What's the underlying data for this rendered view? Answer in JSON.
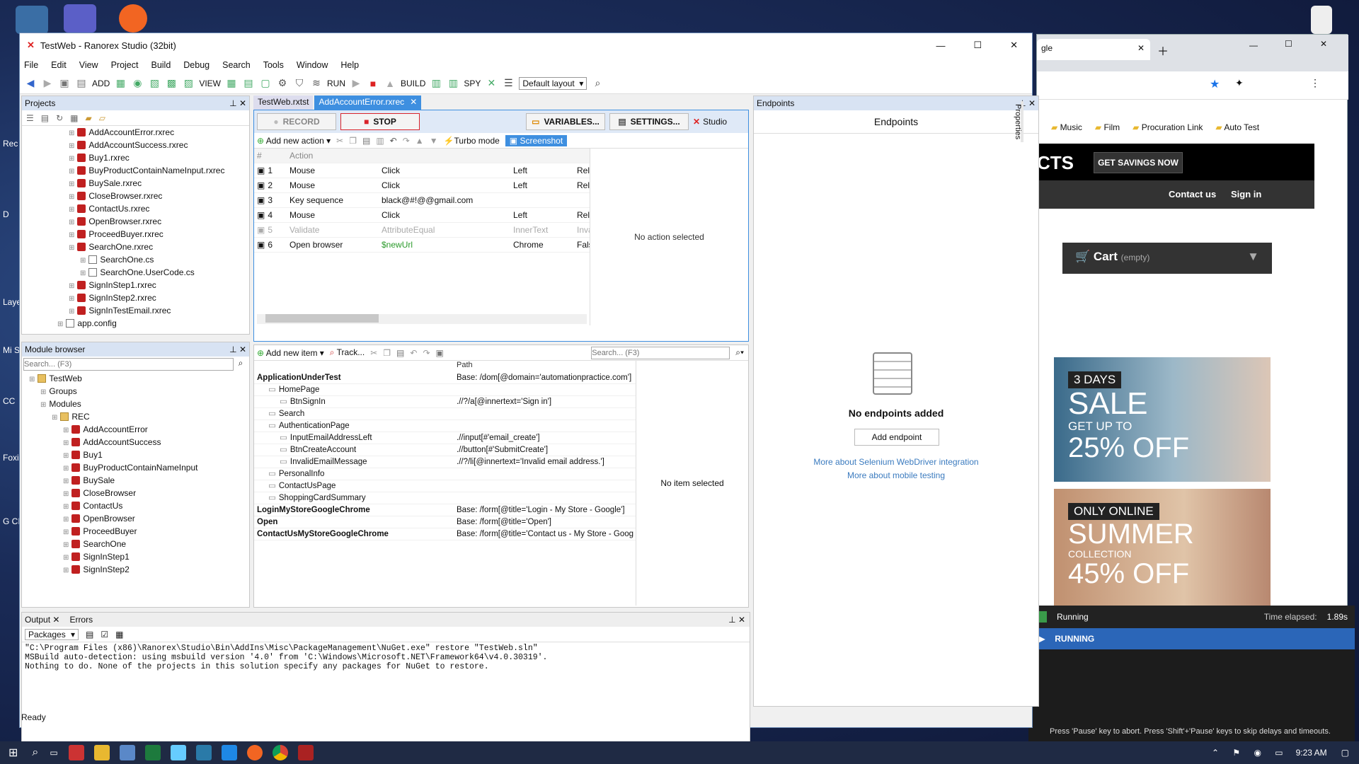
{
  "desktop": {
    "labels": [
      "Rec",
      "D",
      "Laye",
      "Mi SQL",
      "CC",
      "Foxi",
      "G CI"
    ]
  },
  "window": {
    "title": "TestWeb - Ranorex Studio (32bit)"
  },
  "menu": [
    "File",
    "Edit",
    "View",
    "Project",
    "Build",
    "Debug",
    "Search",
    "Tools",
    "Window",
    "Help"
  ],
  "toolbar": {
    "add": "ADD",
    "view": "VIEW",
    "run": "RUN",
    "build": "BUILD",
    "spy": "SPY",
    "layout": "Default layout"
  },
  "projects": {
    "title": "Projects",
    "items": [
      {
        "label": "AddAccountError.rxrec",
        "indent": 1,
        "type": "rx"
      },
      {
        "label": "AddAccountSuccess.rxrec",
        "indent": 1,
        "type": "rx"
      },
      {
        "label": "Buy1.rxrec",
        "indent": 1,
        "type": "rx"
      },
      {
        "label": "BuyProductContainNameInput.rxrec",
        "indent": 1,
        "type": "rx"
      },
      {
        "label": "BuySale.rxrec",
        "indent": 1,
        "type": "rx"
      },
      {
        "label": "CloseBrowser.rxrec",
        "indent": 1,
        "type": "rx"
      },
      {
        "label": "ContactUs.rxrec",
        "indent": 1,
        "type": "rx"
      },
      {
        "label": "OpenBrowser.rxrec",
        "indent": 1,
        "type": "rx"
      },
      {
        "label": "ProceedBuyer.rxrec",
        "indent": 1,
        "type": "rx"
      },
      {
        "label": "SearchOne.rxrec",
        "indent": 1,
        "type": "rx"
      },
      {
        "label": "SearchOne.cs",
        "indent": 2,
        "type": "file"
      },
      {
        "label": "SearchOne.UserCode.cs",
        "indent": 2,
        "type": "file"
      },
      {
        "label": "SignInStep1.rxrec",
        "indent": 1,
        "type": "rx"
      },
      {
        "label": "SignInStep2.rxrec",
        "indent": 1,
        "type": "rx"
      },
      {
        "label": "SignInTestEmail.rxrec",
        "indent": 1,
        "type": "rx"
      },
      {
        "label": "app.config",
        "indent": 0,
        "type": "file"
      }
    ]
  },
  "module_browser": {
    "title": "Module browser",
    "search": "Search... (F3)",
    "items": [
      {
        "label": "TestWeb",
        "indent": 0,
        "type": "folder"
      },
      {
        "label": "Groups",
        "indent": 1,
        "type": "none"
      },
      {
        "label": "Modules",
        "indent": 1,
        "type": "none"
      },
      {
        "label": "REC",
        "indent": 2,
        "type": "folder"
      },
      {
        "label": "AddAccountError",
        "indent": 3,
        "type": "rx"
      },
      {
        "label": "AddAccountSuccess",
        "indent": 3,
        "type": "rx"
      },
      {
        "label": "Buy1",
        "indent": 3,
        "type": "rx"
      },
      {
        "label": "BuyProductContainNameInput",
        "indent": 3,
        "type": "rx"
      },
      {
        "label": "BuySale",
        "indent": 3,
        "type": "rx"
      },
      {
        "label": "CloseBrowser",
        "indent": 3,
        "type": "rx"
      },
      {
        "label": "ContactUs",
        "indent": 3,
        "type": "rx"
      },
      {
        "label": "OpenBrowser",
        "indent": 3,
        "type": "rx"
      },
      {
        "label": "ProceedBuyer",
        "indent": 3,
        "type": "rx"
      },
      {
        "label": "SearchOne",
        "indent": 3,
        "type": "rx"
      },
      {
        "label": "SignInStep1",
        "indent": 3,
        "type": "rx"
      },
      {
        "label": "SignInStep2",
        "indent": 3,
        "type": "rx"
      }
    ]
  },
  "tabs": [
    {
      "label": "TestWeb.rxtst",
      "active": false
    },
    {
      "label": "AddAccountError.rxrec",
      "active": true
    }
  ],
  "recorder": {
    "record": "RECORD",
    "stop": "STOP",
    "variables": "VARIABLES...",
    "settings": "SETTINGS...",
    "studio": "Studio",
    "add_action": "Add new action",
    "turbo": "Turbo mode",
    "screenshot": "Screenshot",
    "col_num": "#",
    "col_action": "Action",
    "actions": [
      {
        "n": "1",
        "type": "Mouse",
        "act": "Click",
        "p1": "Left",
        "p2": "Rela",
        "disabled": false,
        "green": false
      },
      {
        "n": "2",
        "type": "Mouse",
        "act": "Click",
        "p1": "Left",
        "p2": "Rela",
        "disabled": false,
        "green": false
      },
      {
        "n": "3",
        "type": "Key sequence",
        "act": "black@#!@@gmail.com",
        "p1": "",
        "p2": "",
        "disabled": false,
        "green": false
      },
      {
        "n": "4",
        "type": "Mouse",
        "act": "Click",
        "p1": "Left",
        "p2": "Rela",
        "disabled": false,
        "green": false
      },
      {
        "n": "5",
        "type": "Validate",
        "act": "AttributeEqual",
        "p1": "InnerText",
        "p2": "Inva",
        "disabled": true,
        "green": false
      },
      {
        "n": "6",
        "type": "Open browser",
        "act": "$newUrl",
        "p1": "Chrome",
        "p2": "False",
        "disabled": false,
        "green": true
      }
    ],
    "no_action": "No action selected"
  },
  "repository": {
    "add_item": "Add new item",
    "track": "Track...",
    "search": "Search... (F3)",
    "col_path": "Path",
    "no_item": "No item selected",
    "rows": [
      {
        "name": "ApplicationUnderTest",
        "path": "Base: /dom[@domain='automationpractice.com']",
        "indent": 0,
        "bold": true
      },
      {
        "name": "HomePage",
        "path": "",
        "indent": 1,
        "bold": false
      },
      {
        "name": "BtnSignIn",
        "path": ".//?/a[@innertext='Sign in']",
        "indent": 2,
        "bold": false
      },
      {
        "name": "Search",
        "path": "",
        "indent": 1,
        "bold": false
      },
      {
        "name": "AuthenticationPage",
        "path": "",
        "indent": 1,
        "bold": false
      },
      {
        "name": "InputEmailAddressLeft",
        "path": ".//input[#'email_create']",
        "indent": 2,
        "bold": false
      },
      {
        "name": "BtnCreateAccount",
        "path": ".//button[#'SubmitCreate']",
        "indent": 2,
        "bold": false
      },
      {
        "name": "InvalidEmailMessage",
        "path": ".//?/li[@innertext='Invalid email address.']",
        "indent": 2,
        "bold": false
      },
      {
        "name": "PersonalInfo",
        "path": "",
        "indent": 1,
        "bold": false
      },
      {
        "name": "ContactUsPage",
        "path": "",
        "indent": 1,
        "bold": false
      },
      {
        "name": "ShoppingCardSummary",
        "path": "",
        "indent": 1,
        "bold": false
      },
      {
        "name": "LoginMyStoreGoogleChrome",
        "path": "Base: /form[@title='Login - My Store - Google']",
        "indent": 0,
        "bold": true
      },
      {
        "name": "Open",
        "path": "Base: /form[@title='Open']",
        "indent": 0,
        "bold": true
      },
      {
        "name": "ContactUsMyStoreGoogleChrome",
        "path": "Base: /form[@title='Contact us - My Store - Goog",
        "indent": 0,
        "bold": true
      }
    ]
  },
  "endpoints": {
    "title": "Endpoints",
    "heading": "Endpoints",
    "empty": "No endpoints added",
    "add": "Add endpoint",
    "link1": "More about Selenium WebDriver integration",
    "link2": "More about mobile testing"
  },
  "properties": "Properties",
  "output": {
    "tab1": "Output",
    "tab2": "Errors",
    "packages": "Packages",
    "lines": [
      "\"C:\\Program Files (x86)\\Ranorex\\Studio\\Bin\\AddIns\\Misc\\PackageManagement\\NuGet.exe\" restore \"TestWeb.sln\"",
      "MSBuild auto-detection: using msbuild version '4.0' from 'C:\\Windows\\Microsoft.NET\\Framework64\\v4.0.30319'.",
      "Nothing to do. None of the projects in this solution specify any packages for NuGet to restore."
    ]
  },
  "status": "Ready",
  "browser": {
    "tab": "gle",
    "bookmarks": [
      "Music",
      "Film",
      "Procuration Link",
      "Auto Test"
    ],
    "banner": "CTS",
    "savings": "GET SAVINGS NOW",
    "contact": "Contact us",
    "signin": "Sign in",
    "cart": "Cart",
    "cart_empty": "(empty)",
    "promo1": {
      "days": "3 DAYS",
      "sale": "SALE",
      "upto": "GET UP TO",
      "pct": "25% OFF"
    },
    "promo2": {
      "online": "ONLY ONLINE",
      "summer": "SUMMER",
      "coll": "COLLECTION",
      "pct": "45% OFF"
    }
  },
  "runner": {
    "status": "Running",
    "elapsed_label": "Time elapsed:",
    "elapsed": "1.89s",
    "running": "RUNNING",
    "hint": "Press 'Pause' key to abort. Press 'Shift'+'Pause' keys to skip delays and timeouts."
  },
  "taskbar": {
    "time": "9:23 AM"
  },
  "colors": {
    "accent": "#3a7fcf",
    "tab_active": "#3e8fe0",
    "runner_bar": "#2b66b8",
    "stop": "#d9232a"
  }
}
